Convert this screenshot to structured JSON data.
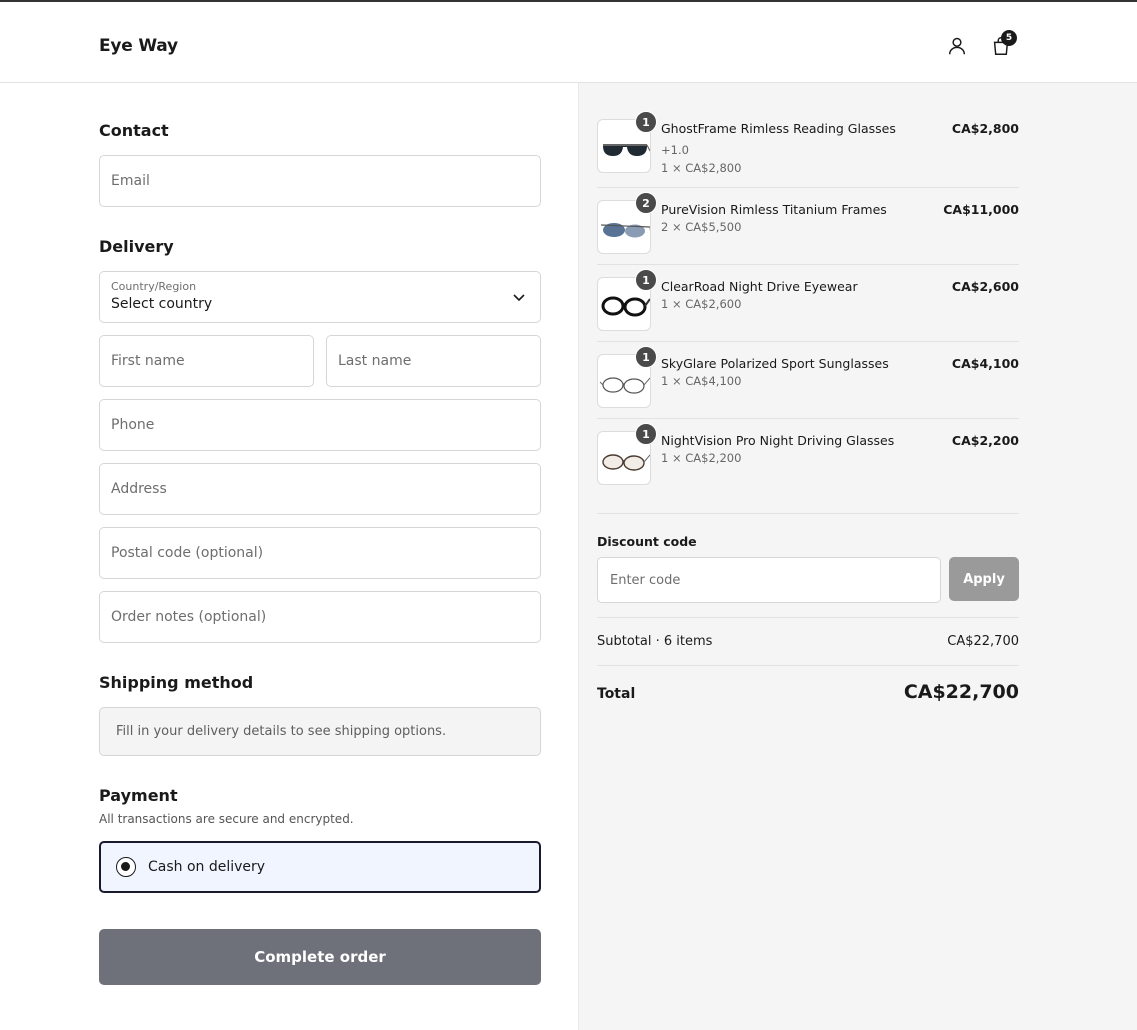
{
  "header": {
    "logo": "Eye Way",
    "cart_count": "5"
  },
  "contact": {
    "title": "Contact",
    "email_placeholder": "Email"
  },
  "delivery": {
    "title": "Delivery",
    "country_label": "Country/Region",
    "country_value": "Select country",
    "first_name_placeholder": "First name",
    "last_name_placeholder": "Last name",
    "phone_placeholder": "Phone",
    "address_placeholder": "Address",
    "postal_placeholder": "Postal code (optional)",
    "notes_placeholder": "Order notes (optional)"
  },
  "shipping": {
    "title": "Shipping method",
    "note": "Fill in your delivery details to see shipping options."
  },
  "payment": {
    "title": "Payment",
    "subtitle": "All transactions are secure and encrypted.",
    "option_label": "Cash on delivery"
  },
  "complete_label": "Complete order",
  "items": [
    {
      "qty": "1",
      "name": "GhostFrame Rimless Reading Glasses",
      "variant": "+1.0",
      "line": "1 × CA$2,800",
      "price": "CA$2,800"
    },
    {
      "qty": "2",
      "name": "PureVision Rimless Titanium Frames",
      "variant": "",
      "line": "2 × CA$5,500",
      "price": "CA$11,000"
    },
    {
      "qty": "1",
      "name": "ClearRoad Night Drive Eyewear",
      "variant": "",
      "line": "1 × CA$2,600",
      "price": "CA$2,600"
    },
    {
      "qty": "1",
      "name": "SkyGlare Polarized Sport Sunglasses",
      "variant": "",
      "line": "1 × CA$4,100",
      "price": "CA$4,100"
    },
    {
      "qty": "1",
      "name": "NightVision Pro Night Driving Glasses",
      "variant": "",
      "line": "1 × CA$2,200",
      "price": "CA$2,200"
    }
  ],
  "discount": {
    "label": "Discount code",
    "placeholder": "Enter code",
    "apply_label": "Apply"
  },
  "summary": {
    "subtotal_label": "Subtotal · 6 items",
    "subtotal_value": "CA$22,700",
    "total_label": "Total",
    "total_value": "CA$22,700"
  }
}
